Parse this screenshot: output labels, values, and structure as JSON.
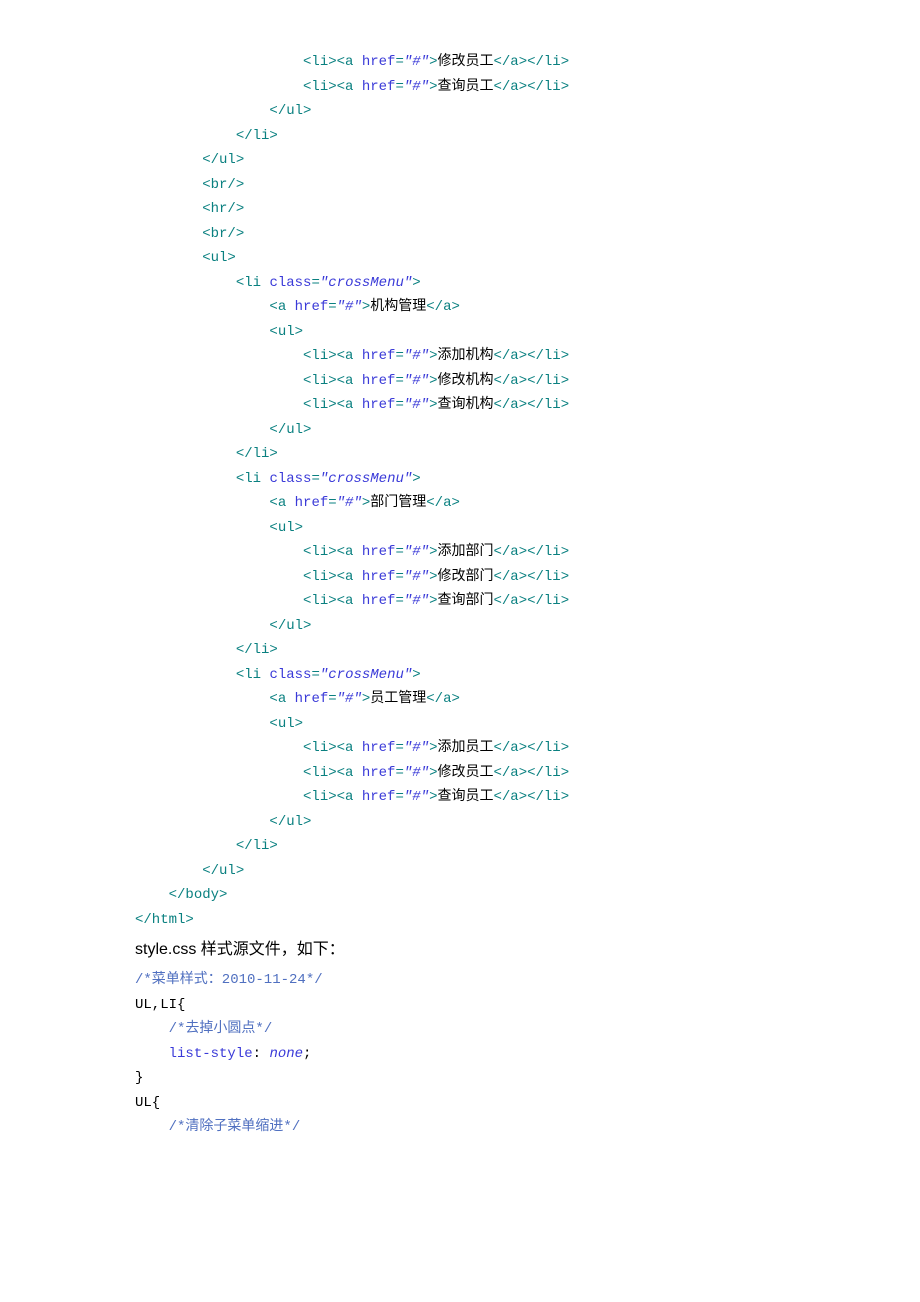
{
  "lines": [
    {
      "indent": 20,
      "parts": [
        {
          "t": "tag",
          "v": "<li><a"
        },
        {
          "t": "attr",
          "v": " href"
        },
        {
          "t": "tag",
          "v": "="
        },
        {
          "t": "val",
          "v": "\"#\""
        },
        {
          "t": "tag",
          "v": ">"
        },
        {
          "t": "text",
          "v": "修改员工"
        },
        {
          "t": "tag",
          "v": "</a></li>"
        }
      ]
    },
    {
      "indent": 20,
      "parts": [
        {
          "t": "tag",
          "v": "<li><a"
        },
        {
          "t": "attr",
          "v": " href"
        },
        {
          "t": "tag",
          "v": "="
        },
        {
          "t": "val",
          "v": "\"#\""
        },
        {
          "t": "tag",
          "v": ">"
        },
        {
          "t": "text",
          "v": "查询员工"
        },
        {
          "t": "tag",
          "v": "</a></li>"
        }
      ]
    },
    {
      "indent": 16,
      "parts": [
        {
          "t": "tag",
          "v": "</ul>"
        }
      ]
    },
    {
      "indent": 12,
      "parts": [
        {
          "t": "tag",
          "v": "</li>"
        }
      ]
    },
    {
      "indent": 8,
      "parts": [
        {
          "t": "tag",
          "v": "</ul>"
        }
      ]
    },
    {
      "indent": 8,
      "parts": [
        {
          "t": "tag",
          "v": "<br/>"
        }
      ]
    },
    {
      "indent": 8,
      "parts": [
        {
          "t": "tag",
          "v": "<hr/>"
        }
      ]
    },
    {
      "indent": 8,
      "parts": [
        {
          "t": "tag",
          "v": "<br/>"
        }
      ]
    },
    {
      "indent": 8,
      "parts": [
        {
          "t": "tag",
          "v": "<ul>"
        }
      ]
    },
    {
      "indent": 12,
      "parts": [
        {
          "t": "tag",
          "v": "<li"
        },
        {
          "t": "attr",
          "v": " class"
        },
        {
          "t": "tag",
          "v": "="
        },
        {
          "t": "val",
          "v": "\"crossMenu\""
        },
        {
          "t": "tag",
          "v": ">"
        }
      ]
    },
    {
      "indent": 16,
      "parts": [
        {
          "t": "tag",
          "v": "<a"
        },
        {
          "t": "attr",
          "v": " href"
        },
        {
          "t": "tag",
          "v": "="
        },
        {
          "t": "val",
          "v": "\"#\""
        },
        {
          "t": "tag",
          "v": ">"
        },
        {
          "t": "text",
          "v": "机构管理"
        },
        {
          "t": "tag",
          "v": "</a>"
        }
      ]
    },
    {
      "indent": 16,
      "parts": [
        {
          "t": "tag",
          "v": "<ul>"
        }
      ]
    },
    {
      "indent": 20,
      "parts": [
        {
          "t": "tag",
          "v": "<li><a"
        },
        {
          "t": "attr",
          "v": " href"
        },
        {
          "t": "tag",
          "v": "="
        },
        {
          "t": "val",
          "v": "\"#\""
        },
        {
          "t": "tag",
          "v": ">"
        },
        {
          "t": "text",
          "v": "添加机构"
        },
        {
          "t": "tag",
          "v": "</a></li>"
        }
      ]
    },
    {
      "indent": 20,
      "parts": [
        {
          "t": "tag",
          "v": "<li><a"
        },
        {
          "t": "attr",
          "v": " href"
        },
        {
          "t": "tag",
          "v": "="
        },
        {
          "t": "val",
          "v": "\"#\""
        },
        {
          "t": "tag",
          "v": ">"
        },
        {
          "t": "text",
          "v": "修改机构"
        },
        {
          "t": "tag",
          "v": "</a></li>"
        }
      ]
    },
    {
      "indent": 20,
      "parts": [
        {
          "t": "tag",
          "v": "<li><a"
        },
        {
          "t": "attr",
          "v": " href"
        },
        {
          "t": "tag",
          "v": "="
        },
        {
          "t": "val",
          "v": "\"#\""
        },
        {
          "t": "tag",
          "v": ">"
        },
        {
          "t": "text",
          "v": "查询机构"
        },
        {
          "t": "tag",
          "v": "</a></li>"
        }
      ]
    },
    {
      "indent": 16,
      "parts": [
        {
          "t": "tag",
          "v": "</ul>"
        }
      ]
    },
    {
      "indent": 12,
      "parts": [
        {
          "t": "tag",
          "v": "</li>"
        }
      ]
    },
    {
      "indent": 12,
      "parts": [
        {
          "t": "tag",
          "v": "<li"
        },
        {
          "t": "attr",
          "v": " class"
        },
        {
          "t": "tag",
          "v": "="
        },
        {
          "t": "val",
          "v": "\"crossMenu\""
        },
        {
          "t": "tag",
          "v": ">"
        }
      ]
    },
    {
      "indent": 16,
      "parts": [
        {
          "t": "tag",
          "v": "<a"
        },
        {
          "t": "attr",
          "v": " href"
        },
        {
          "t": "tag",
          "v": "="
        },
        {
          "t": "val",
          "v": "\"#\""
        },
        {
          "t": "tag",
          "v": ">"
        },
        {
          "t": "text",
          "v": "部门管理"
        },
        {
          "t": "tag",
          "v": "</a>"
        }
      ]
    },
    {
      "indent": 16,
      "parts": [
        {
          "t": "tag",
          "v": "<ul>"
        }
      ]
    },
    {
      "indent": 20,
      "parts": [
        {
          "t": "tag",
          "v": "<li><a"
        },
        {
          "t": "attr",
          "v": " href"
        },
        {
          "t": "tag",
          "v": "="
        },
        {
          "t": "val",
          "v": "\"#\""
        },
        {
          "t": "tag",
          "v": ">"
        },
        {
          "t": "text",
          "v": "添加部门"
        },
        {
          "t": "tag",
          "v": "</a></li>"
        }
      ]
    },
    {
      "indent": 20,
      "parts": [
        {
          "t": "tag",
          "v": "<li><a"
        },
        {
          "t": "attr",
          "v": " href"
        },
        {
          "t": "tag",
          "v": "="
        },
        {
          "t": "val",
          "v": "\"#\""
        },
        {
          "t": "tag",
          "v": ">"
        },
        {
          "t": "text",
          "v": "修改部门"
        },
        {
          "t": "tag",
          "v": "</a></li>"
        }
      ]
    },
    {
      "indent": 20,
      "parts": [
        {
          "t": "tag",
          "v": "<li><a"
        },
        {
          "t": "attr",
          "v": " href"
        },
        {
          "t": "tag",
          "v": "="
        },
        {
          "t": "val",
          "v": "\"#\""
        },
        {
          "t": "tag",
          "v": ">"
        },
        {
          "t": "text",
          "v": "查询部门"
        },
        {
          "t": "tag",
          "v": "</a></li>"
        }
      ]
    },
    {
      "indent": 16,
      "parts": [
        {
          "t": "tag",
          "v": "</ul>"
        }
      ]
    },
    {
      "indent": 12,
      "parts": [
        {
          "t": "tag",
          "v": "</li>"
        }
      ]
    },
    {
      "indent": 12,
      "parts": [
        {
          "t": "tag",
          "v": "<li"
        },
        {
          "t": "attr",
          "v": " class"
        },
        {
          "t": "tag",
          "v": "="
        },
        {
          "t": "val",
          "v": "\"crossMenu\""
        },
        {
          "t": "tag",
          "v": ">"
        }
      ]
    },
    {
      "indent": 16,
      "parts": [
        {
          "t": "tag",
          "v": "<a"
        },
        {
          "t": "attr",
          "v": " href"
        },
        {
          "t": "tag",
          "v": "="
        },
        {
          "t": "val",
          "v": "\"#\""
        },
        {
          "t": "tag",
          "v": ">"
        },
        {
          "t": "text",
          "v": "员工管理"
        },
        {
          "t": "tag",
          "v": "</a>"
        }
      ]
    },
    {
      "indent": 16,
      "parts": [
        {
          "t": "tag",
          "v": "<ul>"
        }
      ]
    },
    {
      "indent": 20,
      "parts": [
        {
          "t": "tag",
          "v": "<li><a"
        },
        {
          "t": "attr",
          "v": " href"
        },
        {
          "t": "tag",
          "v": "="
        },
        {
          "t": "val",
          "v": "\"#\""
        },
        {
          "t": "tag",
          "v": ">"
        },
        {
          "t": "text",
          "v": "添加员工"
        },
        {
          "t": "tag",
          "v": "</a></li>"
        }
      ]
    },
    {
      "indent": 20,
      "parts": [
        {
          "t": "tag",
          "v": "<li><a"
        },
        {
          "t": "attr",
          "v": " href"
        },
        {
          "t": "tag",
          "v": "="
        },
        {
          "t": "val",
          "v": "\"#\""
        },
        {
          "t": "tag",
          "v": ">"
        },
        {
          "t": "text",
          "v": "修改员工"
        },
        {
          "t": "tag",
          "v": "</a></li>"
        }
      ]
    },
    {
      "indent": 20,
      "parts": [
        {
          "t": "tag",
          "v": "<li><a"
        },
        {
          "t": "attr",
          "v": " href"
        },
        {
          "t": "tag",
          "v": "="
        },
        {
          "t": "val",
          "v": "\"#\""
        },
        {
          "t": "tag",
          "v": ">"
        },
        {
          "t": "text",
          "v": "查询员工"
        },
        {
          "t": "tag",
          "v": "</a></li>"
        }
      ]
    },
    {
      "indent": 16,
      "parts": [
        {
          "t": "tag",
          "v": "</ul>"
        }
      ]
    },
    {
      "indent": 12,
      "parts": [
        {
          "t": "tag",
          "v": "</li>"
        }
      ]
    },
    {
      "indent": 8,
      "parts": [
        {
          "t": "tag",
          "v": "</ul>"
        }
      ]
    },
    {
      "indent": 4,
      "parts": [
        {
          "t": "tag",
          "v": "</body>"
        }
      ]
    },
    {
      "indent": 0,
      "parts": [
        {
          "t": "tag",
          "v": "</html>"
        }
      ]
    }
  ],
  "prose": "style.css 样式源文件，如下：",
  "css_lines": [
    {
      "indent": 0,
      "parts": [
        {
          "t": "css-comment",
          "v": "/*菜单样式：2010-11-24*/"
        }
      ]
    },
    {
      "indent": 0,
      "parts": [
        {
          "t": "css-sel",
          "v": "UL,LI{"
        }
      ]
    },
    {
      "indent": 4,
      "parts": [
        {
          "t": "css-comment",
          "v": "/*去掉小圆点*/"
        }
      ]
    },
    {
      "indent": 4,
      "parts": [
        {
          "t": "css-prop",
          "v": "list-style"
        },
        {
          "t": "text",
          "v": ": "
        },
        {
          "t": "css-val",
          "v": "none"
        },
        {
          "t": "text",
          "v": ";"
        }
      ]
    },
    {
      "indent": 0,
      "parts": [
        {
          "t": "css-sel",
          "v": "}"
        }
      ]
    },
    {
      "indent": 0,
      "parts": [
        {
          "t": "css-sel",
          "v": "UL{"
        }
      ]
    },
    {
      "indent": 4,
      "parts": [
        {
          "t": "css-comment",
          "v": "/*清除子菜单缩进*/"
        }
      ]
    }
  ]
}
